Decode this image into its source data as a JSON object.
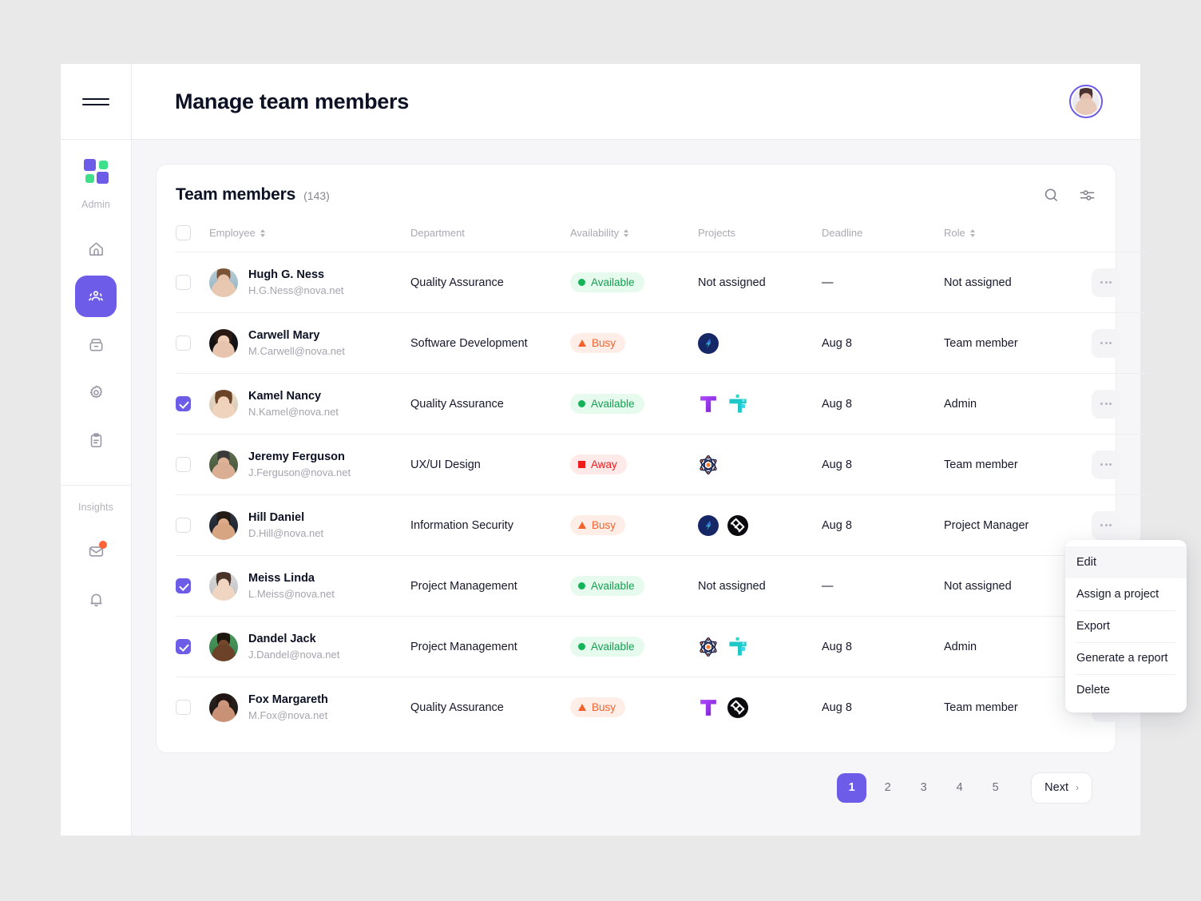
{
  "header": {
    "title": "Manage team members",
    "menu_icon": "hamburger-icon",
    "avatar": "user-avatar"
  },
  "sidebar": {
    "logo": "app-logo",
    "section_admin_label": "Admin",
    "section_insights_label": "Insights",
    "admin_items": [
      {
        "icon": "home-icon",
        "name": "home",
        "active": false
      },
      {
        "icon": "users-icon",
        "name": "team-members",
        "active": true
      },
      {
        "icon": "archive-icon",
        "name": "archive",
        "active": false
      },
      {
        "icon": "gear-icon",
        "name": "settings",
        "active": false
      },
      {
        "icon": "clipboard-icon",
        "name": "reports",
        "active": false
      }
    ],
    "insights_items": [
      {
        "icon": "mail-icon",
        "name": "messages",
        "badge": true
      },
      {
        "icon": "bell-icon",
        "name": "notifications",
        "badge": false
      }
    ]
  },
  "card": {
    "title": "Team members",
    "count": "(143)",
    "search_icon": "search-icon",
    "filter_icon": "filter-sliders-icon"
  },
  "table": {
    "columns": [
      {
        "label": "",
        "sortable": false,
        "key": "check"
      },
      {
        "label": "Employee",
        "sortable": true,
        "key": "employee"
      },
      {
        "label": "Department",
        "sortable": false,
        "key": "department"
      },
      {
        "label": "Availability",
        "sortable": true,
        "key": "availability"
      },
      {
        "label": "Projects",
        "sortable": false,
        "key": "projects"
      },
      {
        "label": "Deadline",
        "sortable": false,
        "key": "deadline"
      },
      {
        "label": "Role",
        "sortable": true,
        "key": "role"
      },
      {
        "label": "",
        "sortable": false,
        "key": "actions"
      }
    ],
    "rows": [
      {
        "selected": false,
        "name": "Hugh G. Ness",
        "email": "H.G.Ness@nova.net",
        "department": "Quality Assurance",
        "availability": "Available",
        "availability_state": "available",
        "projects": [],
        "projects_text": "Not assigned",
        "deadline": "—",
        "role": "Not assigned"
      },
      {
        "selected": false,
        "name": "Carwell Mary",
        "email": "M.Carwell@nova.net",
        "department": "Software Development",
        "availability": "Busy",
        "availability_state": "busy",
        "projects": [
          "swirl"
        ],
        "projects_text": "",
        "deadline": "Aug 8",
        "role": "Team member"
      },
      {
        "selected": true,
        "name": "Kamel Nancy",
        "email": "N.Kamel@nova.net",
        "department": "Quality Assurance",
        "availability": "Available",
        "availability_state": "available",
        "projects": [
          "tee",
          "cluster"
        ],
        "projects_text": "",
        "deadline": "Aug 8",
        "role": "Admin"
      },
      {
        "selected": false,
        "name": "Jeremy Ferguson",
        "email": "J.Ferguson@nova.net",
        "department": "UX/UI Design",
        "availability": "Away",
        "availability_state": "away",
        "projects": [
          "atom"
        ],
        "projects_text": "",
        "deadline": "Aug 8",
        "role": "Team member"
      },
      {
        "selected": false,
        "name": "Hill Daniel",
        "email": "D.Hill@nova.net",
        "department": "Information Security",
        "availability": "Busy",
        "availability_state": "busy",
        "projects": [
          "swirl",
          "weave"
        ],
        "projects_text": "",
        "deadline": "Aug 8",
        "role": "Project Manager"
      },
      {
        "selected": true,
        "name": "Meiss Linda",
        "email": "L.Meiss@nova.net",
        "department": "Project Management",
        "availability": "Available",
        "availability_state": "available",
        "projects": [],
        "projects_text": "Not assigned",
        "deadline": "—",
        "role": "Not assigned"
      },
      {
        "selected": true,
        "name": "Dandel Jack",
        "email": "J.Dandel@nova.net",
        "department": "Project Management",
        "availability": "Available",
        "availability_state": "available",
        "projects": [
          "atom",
          "cluster"
        ],
        "projects_text": "",
        "deadline": "Aug 8",
        "role": "Admin"
      },
      {
        "selected": false,
        "name": "Fox Margareth",
        "email": "M.Fox@nova.net",
        "department": "Quality Assurance",
        "availability": "Busy",
        "availability_state": "busy",
        "projects": [
          "tee",
          "weave"
        ],
        "projects_text": "",
        "deadline": "Aug 8",
        "role": "Team member"
      }
    ]
  },
  "context_menu": {
    "visible": true,
    "items": [
      {
        "label": "Edit",
        "highlighted": true
      },
      {
        "label": "Assign a project",
        "highlighted": false
      },
      {
        "label": "Export",
        "highlighted": false
      },
      {
        "label": "Generate a report",
        "highlighted": false
      },
      {
        "label": "Delete",
        "highlighted": false
      }
    ]
  },
  "pagination": {
    "pages": [
      "1",
      "2",
      "3",
      "4",
      "5"
    ],
    "current": "1",
    "next_label": "Next"
  },
  "colors": {
    "accent": "#6c5ce7",
    "available": "#12a150",
    "busy": "#f4622c",
    "away": "#f01b1b",
    "badge": "#ff6336"
  }
}
